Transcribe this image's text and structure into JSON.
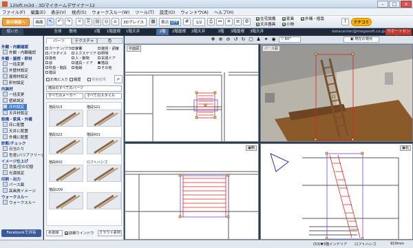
{
  "window": {
    "title": "12loft.m3d - 3Dマイホームデザイナー12"
  },
  "menu": [
    "ファイル(F)",
    "編集(E)",
    "表示(V)",
    "視点(S)",
    "ウォークスルー(W)",
    "ツール(T)",
    "設定(O)",
    "ウィンドウ(A)",
    "ヘルプ(H)"
  ],
  "toolbar": {
    "prev_label": "前の画面へ",
    "view_mode_label": "画面",
    "place_3d_label": "3Dプレイス",
    "display_label": "表示",
    "display_value": "OFF",
    "scale_value": "1/2",
    "checks": {
      "residence_info": "住宅設備",
      "ceiling_fixtures": "天井器具",
      "furniture": "家具",
      "small_items": "小物",
      "exterior_planting": "外構・植栽"
    },
    "kuchi_label": "クチコミ"
  },
  "floorbar": {
    "left_tabs": [
      "全体",
      "敷地"
    ],
    "floors": [
      "1階",
      "1階屋根",
      "1階天井",
      "2階",
      "2階屋根",
      "2階天井",
      "3階",
      "3階屋根",
      "3階天井"
    ],
    "active_floor": "2階",
    "email": "datacenter@megasoft.co.jp",
    "support_label": "サポートセンター"
  },
  "leftnav": {
    "usage_label": "使い方",
    "sections": [
      {
        "title": "外観・内観確認",
        "items": [
          "外観・内観確認"
        ]
      },
      {
        "title": "外観・屋根・軒材",
        "items": [
          "一括変更",
          "外壁材設定",
          "屋根材設定",
          "軒材設定"
        ]
      },
      {
        "title": "内装材",
        "items": [
          "一括変更",
          "壁紙設定",
          "床材設定",
          "天井材設定"
        ]
      },
      {
        "title": "設備・家具・外構",
        "items": [
          "床に配置",
          "天井に配置",
          "外構に配置"
        ]
      },
      {
        "title": "診断/チェック",
        "items": [
          "日当たり",
          "色覚(バリアフリー)"
        ]
      },
      {
        "title": "イメージ仕上げ",
        "items": [
          "背景/空の切替",
          "光源設定"
        ]
      },
      {
        "title": "印刷・出力",
        "items": [
          "パース図",
          "高画質イメージ"
        ]
      },
      {
        "title": "ウォークスルー",
        "items": [
          "ウォークスルー"
        ]
      }
    ],
    "selected_item": "床材設定",
    "facebook_label": "Facebookで共有"
  },
  "parts": {
    "tabs": [
      "パーツ",
      "テクスチャ",
      "色"
    ],
    "categories": [
      "カーテン/ブラインド",
      "家電",
      "雑貨・調度",
      "パラダイス",
      "エクステリア",
      "照明",
      "換気",
      "人・動物",
      "玄関ドア",
      "窓",
      "建具・ドア",
      "階段",
      "吹抜・階段",
      "植栽",
      "その他",
      "階段"
    ],
    "links": [
      "お気に入り",
      "履歴",
      "検索結果"
    ],
    "filter1": "階段のすべてのパーツ",
    "filter2": "すべてのメーカー",
    "filter3": "すべてのスタイル",
    "items": [
      "階段S15",
      "階段S21",
      "階段S22",
      "階段R01",
      "階段R02",
      "ロフトハシゴ",
      "階段U09",
      ""
    ],
    "footer": {
      "sort_label": "名前順",
      "detail_label": "詳細ウインドウ",
      "cloud_label": "クラウド素材"
    }
  },
  "views": {
    "top_left_label": "平面図",
    "top_right_label": "パース図",
    "bottom_left_label": "",
    "bottom_right_label": "",
    "current_view_label": "現在の視点",
    "fov_value": "60°"
  },
  "status": {
    "left": "",
    "right_1": "(53)▼3階インテリア",
    "right_2": "ロフトハシゴ",
    "right_3": "910mm"
  }
}
